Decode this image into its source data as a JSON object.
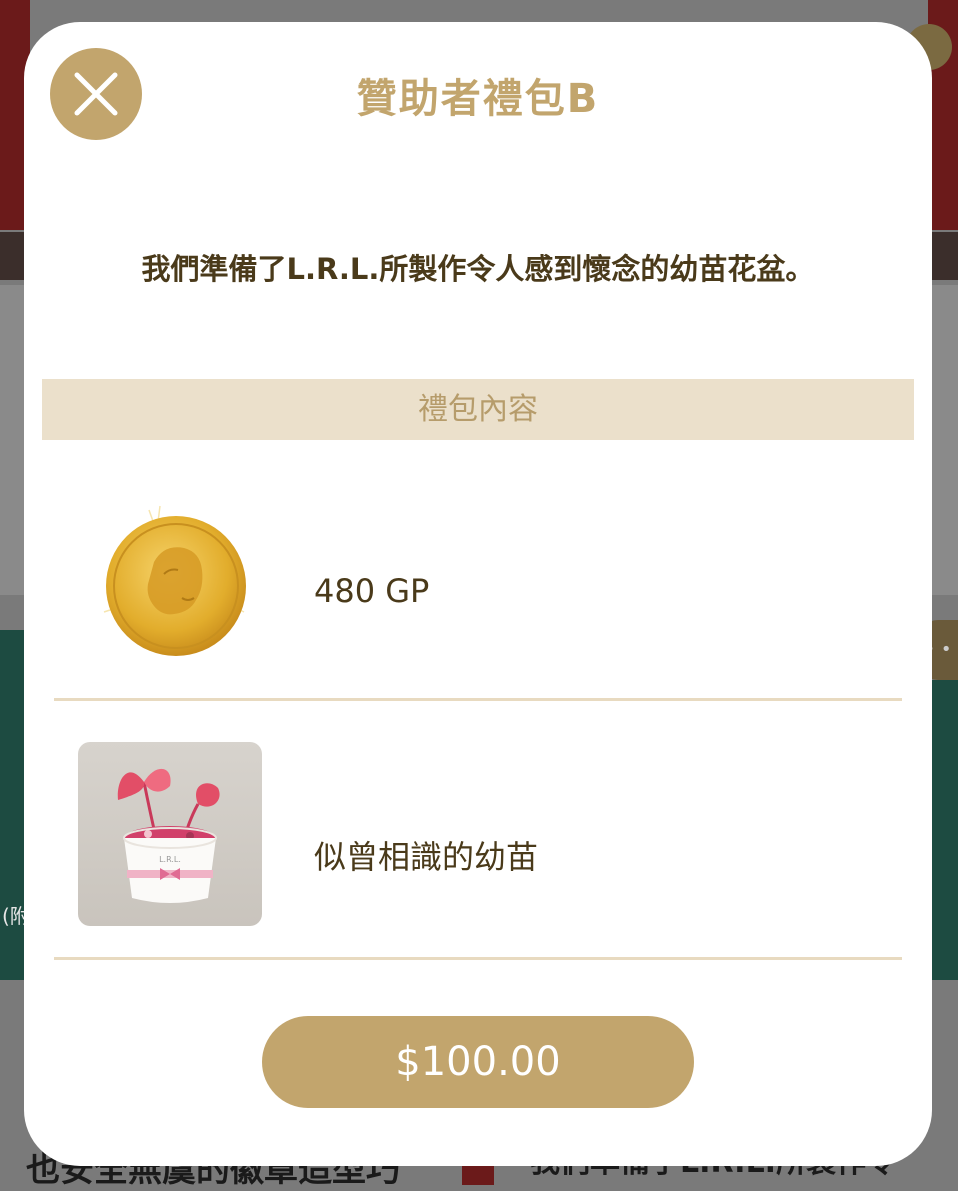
{
  "modal": {
    "title": "贊助者禮包B",
    "description": "我們準備了L.R.L.所製作令人感到懷念的幼苗花盆。",
    "section_header": "禮包內容",
    "items": [
      {
        "name": "480 GP",
        "icon": "gold-coin-icon"
      },
      {
        "name": "似曾相識的幼苗",
        "icon": "seedling-pot-icon"
      }
    ],
    "price": "$100.00",
    "close_icon": "close-icon"
  },
  "background": {
    "left_partial_text": "(附",
    "bottom_left_text": "也安全無虞的徽章造型巧",
    "bottom_right_text": "我們準備了L.R.L.所製作令"
  },
  "colors": {
    "accent": "#c2a56d",
    "section_bg": "#ebe0cb",
    "text_dark": "#4a3a1a"
  }
}
